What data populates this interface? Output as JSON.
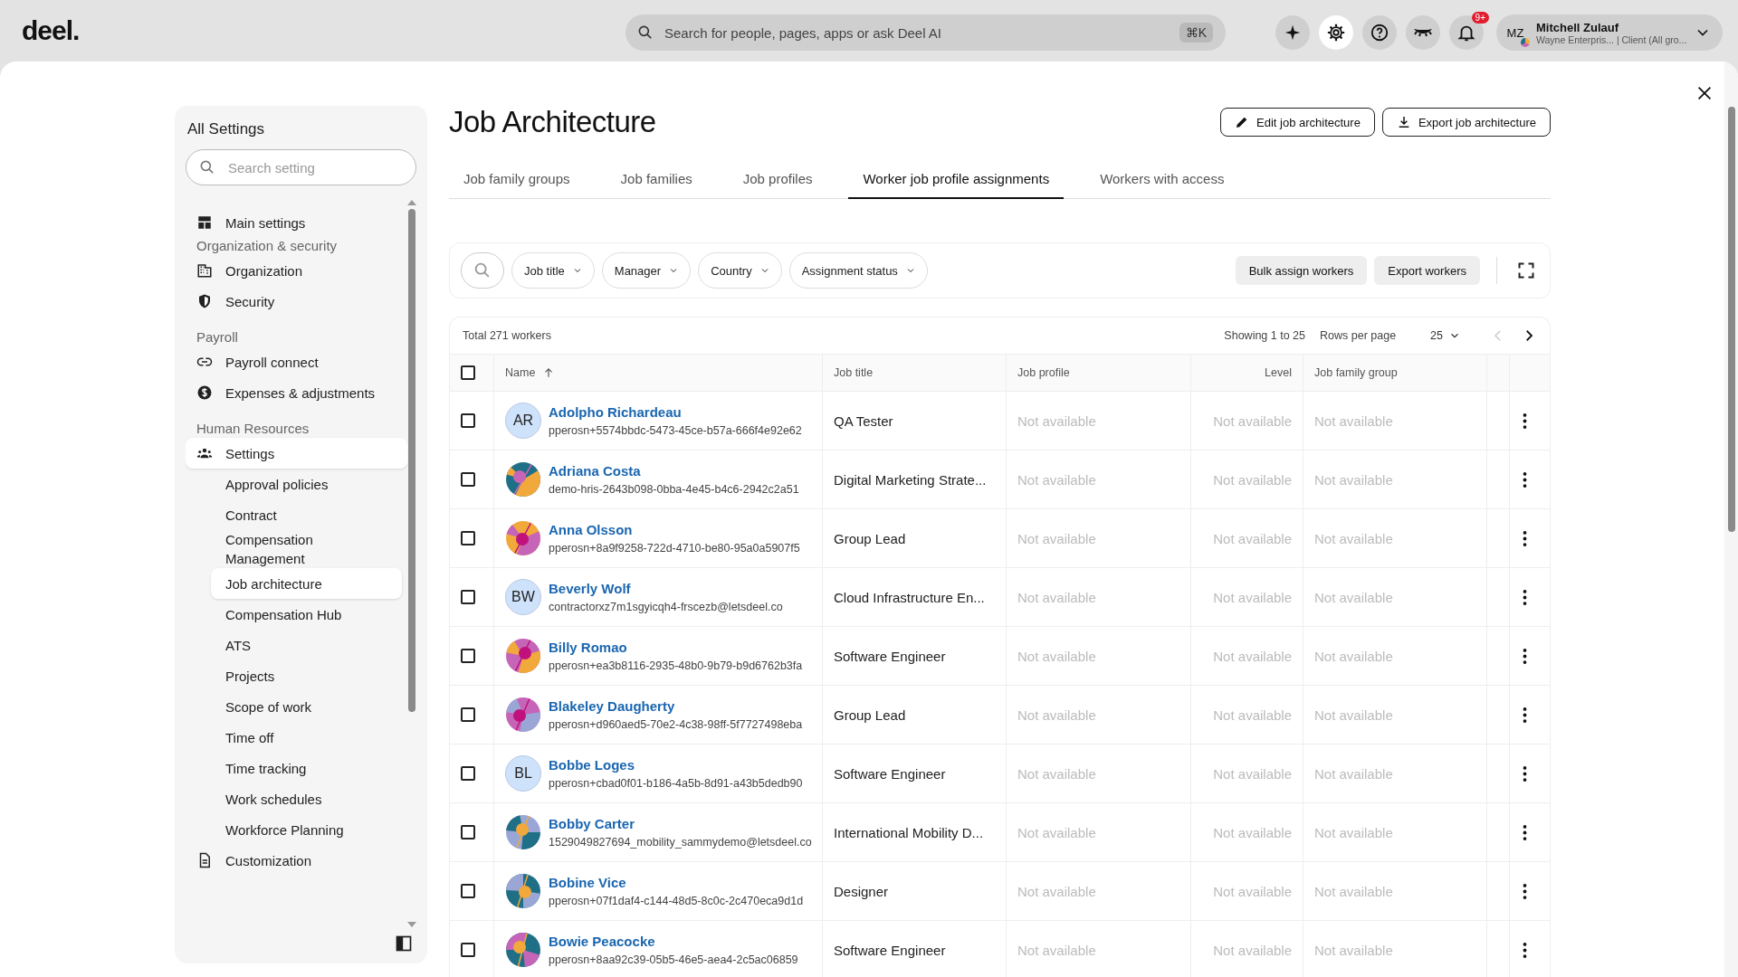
{
  "topbar": {
    "logo": "deel.",
    "search": {
      "placeholder": "Search for people, pages, apps or ask Deel AI",
      "shortcut": "⌘K"
    },
    "notifications_badge": "9+",
    "settings_active": true,
    "user": {
      "initials": "MZ",
      "name": "Mitchell Zulauf",
      "subtitle": "Wayne Enterpris... | Client (All gro..."
    }
  },
  "sidebar": {
    "title": "All Settings",
    "search": {
      "placeholder": "Search setting"
    },
    "items": [
      {
        "kind": "item",
        "label": "Main settings",
        "selected": false
      },
      {
        "kind": "section",
        "label": "Organization & security"
      },
      {
        "kind": "item",
        "label": "Organization",
        "selected": false
      },
      {
        "kind": "item",
        "label": "Security",
        "selected": false
      },
      {
        "kind": "section",
        "label": "Payroll"
      },
      {
        "kind": "item",
        "label": "Payroll connect",
        "selected": false
      },
      {
        "kind": "item",
        "label": "Expenses & adjustments",
        "selected": false
      },
      {
        "kind": "section",
        "label": "Human Resources"
      },
      {
        "kind": "item",
        "label": "Settings",
        "expanded": true,
        "selected": true,
        "children": [
          {
            "label": "Approval policies",
            "selected": false
          },
          {
            "label": "Contract",
            "selected": false
          },
          {
            "label": "Compensation Management",
            "selected": false
          },
          {
            "label": "Job architecture",
            "selected": true
          },
          {
            "label": "Compensation Hub",
            "selected": false
          },
          {
            "label": "ATS",
            "selected": false
          },
          {
            "label": "Projects",
            "selected": false
          },
          {
            "label": "Scope of work",
            "selected": false
          },
          {
            "label": "Time off",
            "selected": false
          },
          {
            "label": "Time tracking",
            "selected": false
          },
          {
            "label": "Work schedules",
            "selected": false
          },
          {
            "label": "Workforce Planning",
            "selected": false
          }
        ]
      },
      {
        "kind": "item",
        "label": "Customization",
        "selected": false
      }
    ]
  },
  "page": {
    "title": "Job Architecture",
    "actions": [
      "Edit job architecture",
      "Export job architecture"
    ],
    "tabs": [
      {
        "label": "Job family groups",
        "selected": false
      },
      {
        "label": "Job families",
        "selected": false
      },
      {
        "label": "Job profiles",
        "selected": false
      },
      {
        "label": "Worker job profile assignments",
        "selected": true
      },
      {
        "label": "Workers with access",
        "selected": false
      }
    ],
    "filters": [
      "Job title",
      "Manager",
      "Country",
      "Assignment status"
    ],
    "toolbar_buttons": [
      "Bulk assign workers",
      "Export workers"
    ],
    "table": {
      "total": "Total 271 workers",
      "showing": "Showing 1 to 25",
      "rows_per_page_label": "Rows per page",
      "rows_per_page": "25",
      "prev_disabled": true,
      "next_disabled": false,
      "select_all_checked": false,
      "columns": [
        {
          "label": "Name",
          "sorted": true
        },
        {
          "label": "Job title",
          "sorted": false
        },
        {
          "label": "Job profile",
          "sorted": false
        },
        {
          "label": "Level",
          "sorted": false
        },
        {
          "label": "Job family group",
          "sorted": false
        }
      ],
      "rows": [
        {
          "avatar": {
            "kind": "initials",
            "initials": "AR"
          },
          "name": "Adolpho Richardeau",
          "email": "pperosn+5574bbdc-5473-45ce-b57a-666f4e92e62",
          "job_title": "QA Tester",
          "job_profile": "Not available",
          "level": "Not available",
          "job_family_group": "Not available",
          "checked": false
        },
        {
          "name": "Adriana Costa",
          "email": "demo-hris-2643b098-0bba-4e45-b4c6-2942c2a51",
          "job_title": "Digital Marketing Strate...",
          "job_profile": "Not available",
          "level": "Not available",
          "job_family_group": "Not available",
          "checked": false
        },
        {
          "name": "Anna Olsson",
          "email": "pperosn+8a9f9258-722d-4710-be80-95a0a5907f5",
          "job_title": "Group Lead",
          "job_profile": "Not available",
          "level": "Not available",
          "job_family_group": "Not available",
          "checked": false
        },
        {
          "avatar": {
            "kind": "initials",
            "initials": "BW"
          },
          "name": "Beverly Wolf",
          "email": "contractorxz7m1sgyicqh4-frscezb@letsdeel.co",
          "job_title": "Cloud Infrastructure En...",
          "job_profile": "Not available",
          "level": "Not available",
          "job_family_group": "Not available",
          "checked": false
        },
        {
          "name": "Billy Romao",
          "email": "pperosn+ea3b8116-2935-48b0-9b79-b9d6762b3fa",
          "job_title": "Software Engineer",
          "job_profile": "Not available",
          "level": "Not available",
          "job_family_group": "Not available",
          "checked": false
        },
        {
          "name": "Blakeley Daugherty",
          "email": "pperosn+d960aed5-70e2-4c38-98ff-5f7727498eba",
          "job_title": "Group Lead",
          "job_profile": "Not available",
          "level": "Not available",
          "job_family_group": "Not available",
          "checked": false
        },
        {
          "avatar": {
            "kind": "initials",
            "initials": "BL"
          },
          "name": "Bobbe Loges",
          "email": "pperosn+cbad0f01-b186-4a5b-8d91-a43b5dedb90",
          "job_title": "Software Engineer",
          "job_profile": "Not available",
          "level": "Not available",
          "job_family_group": "Not available",
          "checked": false
        },
        {
          "name": "Bobby Carter",
          "email": "1529049827694_mobility_sammydemo@letsdeel.co",
          "job_title": "International Mobility D...",
          "job_profile": "Not available",
          "level": "Not available",
          "job_family_group": "Not available",
          "checked": false
        },
        {
          "name": "Bobine Vice",
          "email": "pperosn+07f1daf4-c144-48d5-8c0c-2c470eca9d1d",
          "job_title": "Designer",
          "job_profile": "Not available",
          "level": "Not available",
          "job_family_group": "Not available",
          "checked": false
        },
        {
          "name": "Bowie Peacocke",
          "email": "pperosn+8aa92c39-05b5-46e5-aea4-2c5ac06859",
          "job_title": "Software Engineer",
          "job_profile": "Not available",
          "level": "Not available",
          "job_family_group": "Not available",
          "checked": false
        }
      ]
    }
  }
}
